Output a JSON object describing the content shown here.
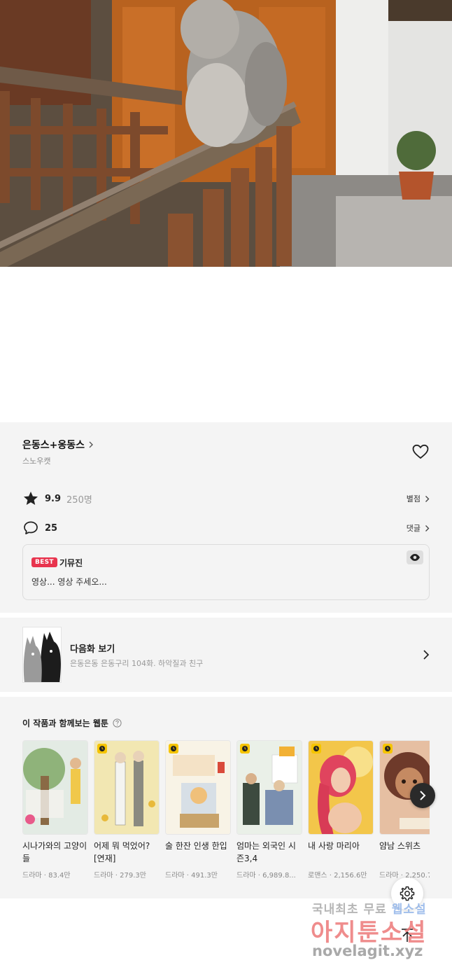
{
  "series": {
    "title": "은동스+옹동스",
    "author": "스노우캣"
  },
  "rating": {
    "score": "9.9",
    "count": "250명",
    "link_label": "별점"
  },
  "comments": {
    "count": "25",
    "link_label": "댓글"
  },
  "best_comment": {
    "badge": "BEST",
    "user": "기뮤진",
    "text": "영상... 영상 주세오..."
  },
  "next_episode": {
    "label": "다음화 보기",
    "subtitle": "은동은동 은동구리 104화. 하악질과 친구"
  },
  "recommendations": {
    "title": "이 작품과 함께보는 웹툰",
    "items": [
      {
        "title": "시나가와의 고양이들",
        "meta": "드라마 · 83.4만",
        "cover_bg": "#e8eef0"
      },
      {
        "title": "어제 뭐 먹었어? [연재]",
        "meta": "드라마 · 279.3만",
        "cover_bg": "#f2e6b0"
      },
      {
        "title": "술 한잔 인생 한입",
        "meta": "드라마 · 491.3만",
        "cover_bg": "#f6f1e4"
      },
      {
        "title": "엄마는 외국인 시즌3,4",
        "meta": "드라마 · 6,989.8...",
        "cover_bg": "#e9efe6"
      },
      {
        "title": "내 사랑 마리아",
        "meta": "로맨스 · 2,156.6만",
        "cover_bg": "#f2c84b"
      },
      {
        "title": "얌남 스위츠",
        "meta": "드라마 · 2,250.7",
        "cover_bg": "#e8c3a8"
      }
    ]
  },
  "watermark": {
    "line1_a": "국내최초 무료",
    "line1_b": "웹소설",
    "line2": "아지툰소설",
    "line3": "novelagit.xyz"
  },
  "icons": {
    "rating": "star-icon",
    "comments": "speech-bubble-icon",
    "favorite": "heart-icon",
    "settings": "gear-icon",
    "scroll_top": "arrow-up-icon"
  },
  "colors": {
    "best_badge": "#e8344e",
    "section_bg": "#f4f4f4",
    "free_badge": "#f5c400"
  }
}
